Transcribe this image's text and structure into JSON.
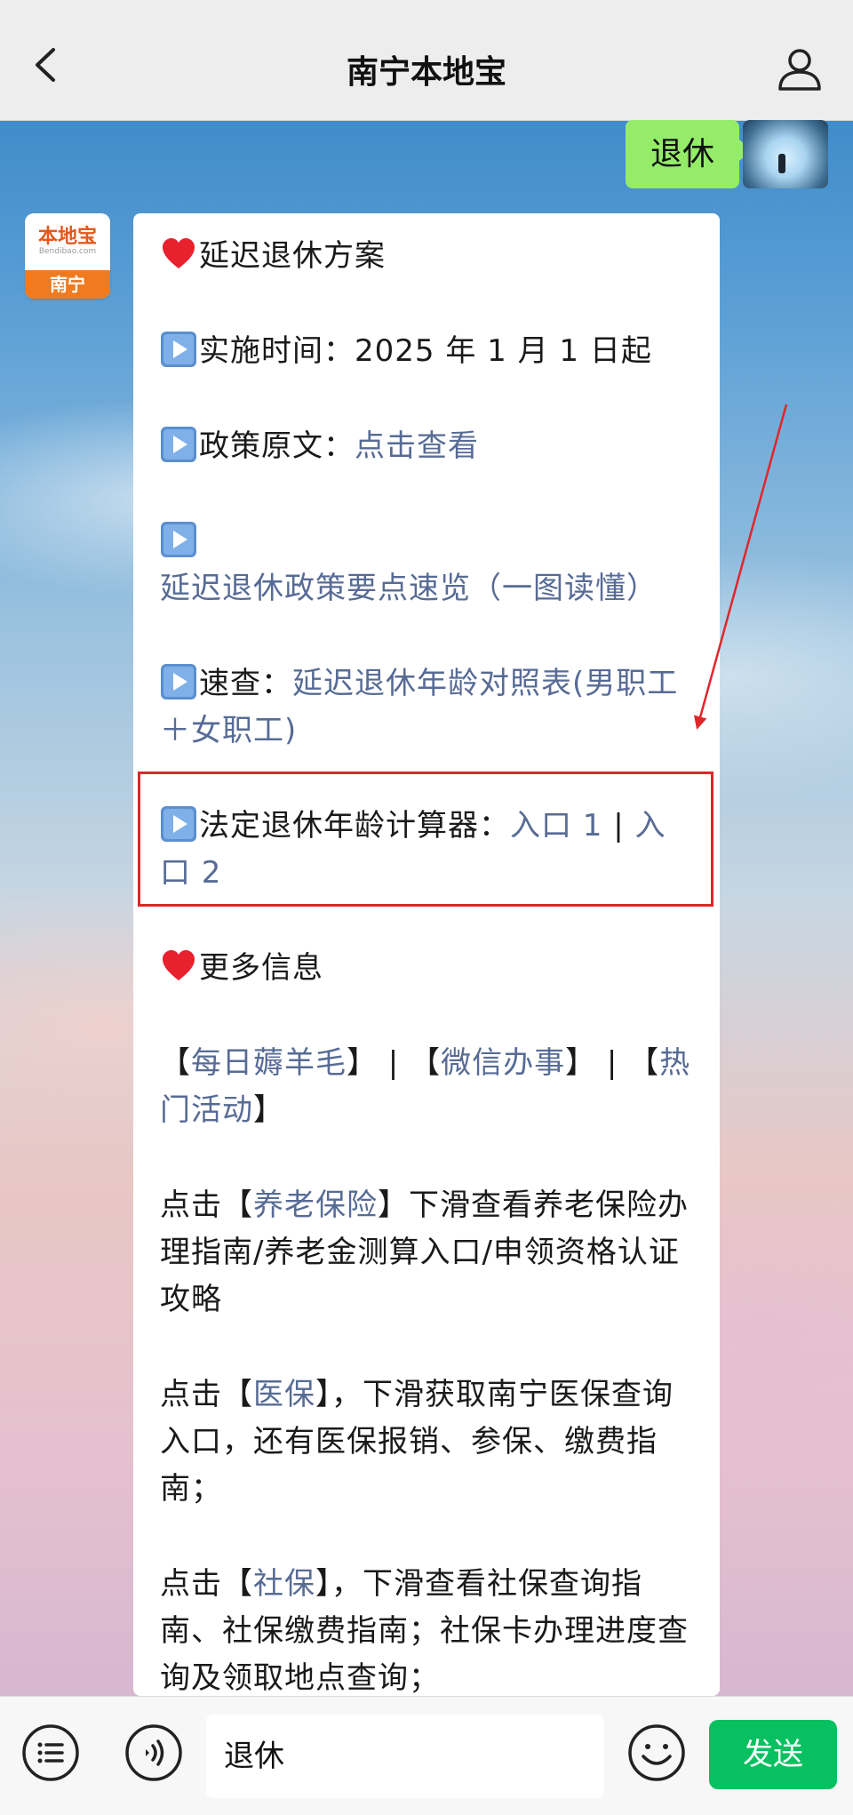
{
  "header": {
    "title": "南宁本地宝"
  },
  "user_message": {
    "text": "退休"
  },
  "bot_avatar": {
    "logo_text": "本地宝",
    "logo_sub": "Bendibao.com",
    "city": "南宁"
  },
  "message": {
    "section1_title": "延迟退休方案",
    "item1": "实施时间：2025 年 1 月 1 日起",
    "item2_label": "政策原文：",
    "item2_link": "点击查看",
    "item3_link": "延迟退休政策要点速览（一图读懂）",
    "item4_label": "速查：",
    "item4_link": "延迟退休年龄对照表(男职工＋女职工)",
    "item5_label": "法定退休年龄计算器：",
    "item5_link1": "入口 1",
    "item5_sep": " | ",
    "item5_link2": "入口 2",
    "section2_title": "更多信息",
    "links_row": {
      "bracket_open": "【",
      "bracket_close": "】",
      "sep": " | ",
      "link1": "每日薅羊毛",
      "link2": "微信办事",
      "link3": "热门活动"
    },
    "para1_prefix": "点击【",
    "para1_link": "养老保险",
    "para1_suffix": "】下滑查看养老保险办理指南/养老金测算入口/申领资格认证攻略",
    "para2_prefix": "点击【",
    "para2_link": "医保",
    "para2_suffix": "】，下滑获取南宁医保查询入口，还有医保报销、参保、缴费指南；",
    "para3_prefix": "点击【",
    "para3_link": "社保",
    "para3_suffix": "】，下滑查看社保查询指南、社保缴费指南；社保卡办理进度查询及领取地点查询；"
  },
  "input_bar": {
    "value": "退休",
    "send_label": "发送"
  },
  "colors": {
    "link": "#576b95",
    "send": "#07c160",
    "user_bubble": "#95ec69",
    "annotation": "#e0262b"
  },
  "icons": [
    "back-icon",
    "person-icon",
    "menu-list-icon",
    "voice-icon",
    "emoji-icon",
    "play-marker-icon",
    "heart-icon"
  ]
}
